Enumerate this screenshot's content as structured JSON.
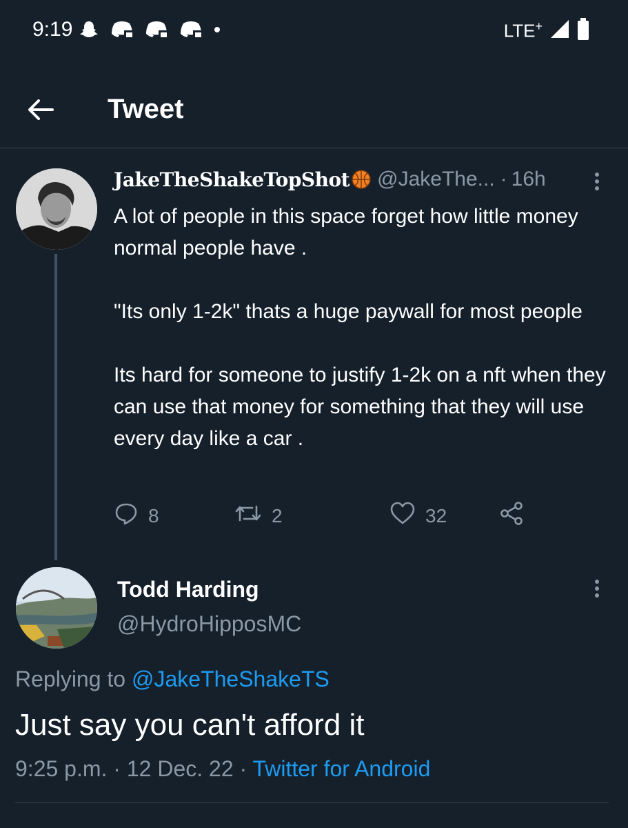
{
  "status_bar": {
    "time": "9:19",
    "network": "LTE",
    "network_suffix": "+",
    "icons": [
      "snapchat-icon",
      "discord-icon",
      "discord-icon",
      "discord-icon",
      "notification-dot-icon",
      "signal-icon",
      "battery-icon"
    ]
  },
  "header": {
    "back_icon": "arrow-left-icon",
    "title": "Tweet"
  },
  "original_tweet": {
    "display_name": "JakeTheShakeTopShot",
    "name_emoji": "🏀",
    "handle": "@JakeThe...",
    "separator": "·",
    "time": "16h",
    "paragraphs": [
      "A lot of people in this space forget how little money normal people have .",
      "\"Its only 1-2k\" thats a huge paywall for most people",
      "Its hard for someone to justify 1-2k on a nft when they can use that money for something that they will use every day like a car ."
    ],
    "actions": {
      "replies": "8",
      "retweets": "2",
      "likes": "32"
    }
  },
  "reply_tweet": {
    "display_name": "Todd Harding",
    "handle": "@HydroHipposMC",
    "replying_prefix": "Replying to",
    "replying_to": "@JakeTheShakeTS",
    "text": "Just say you can't afford it",
    "timestamp": "9:25 p.m. · 12 Dec. 22 ·",
    "source": "Twitter for Android"
  },
  "colors": {
    "background": "#15202b",
    "secondary_text": "#8b98a5",
    "link": "#1d9bf0",
    "divider": "#38444d"
  }
}
